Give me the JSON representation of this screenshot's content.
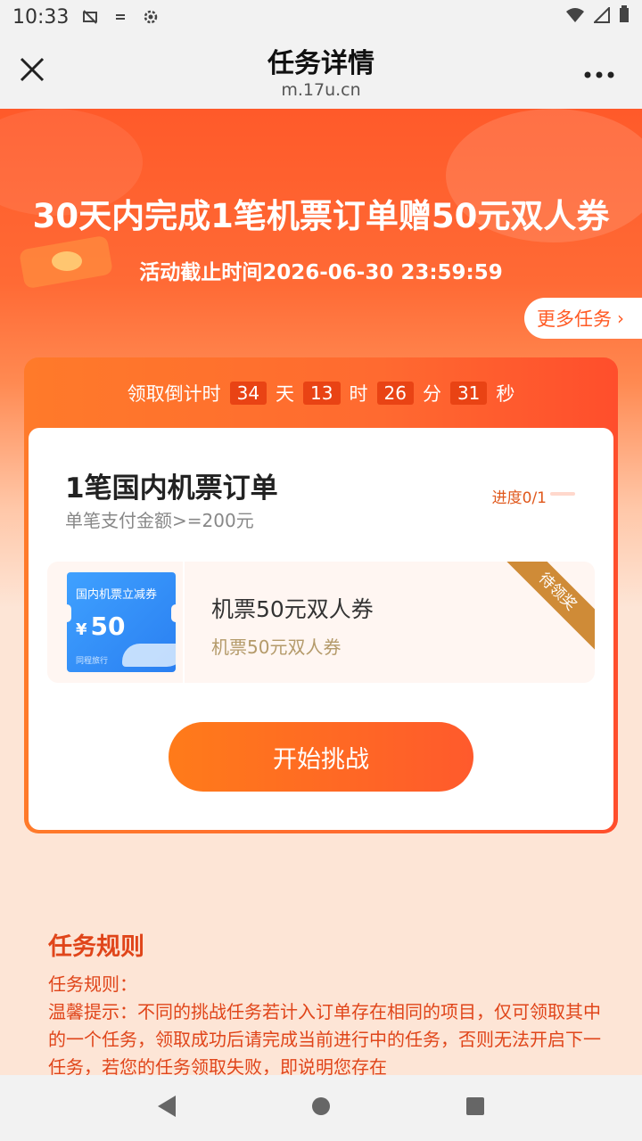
{
  "status_bar": {
    "time": "10:33"
  },
  "nav": {
    "title": "任务详情",
    "url": "m.17u.cn"
  },
  "hero": {
    "title": "30天内完成1笔机票订单赠50元双人券",
    "deadline": "活动截止时间2026-06-30 23:59:59",
    "more_tasks": "更多任务"
  },
  "countdown": {
    "label": "领取倒计时",
    "days": "34",
    "days_unit": "天",
    "hours": "13",
    "hours_unit": "时",
    "minutes": "26",
    "minutes_unit": "分",
    "seconds": "31",
    "seconds_unit": "秒"
  },
  "task": {
    "title": "1笔国内机票订单",
    "subtitle": "单笔支付金额>=200元",
    "progress_text": "进度0/1",
    "progress_fraction": 0
  },
  "reward": {
    "coupon_title": "国内机票立减券",
    "coupon_currency": "¥",
    "coupon_amount": "50",
    "coupon_brand": "同程旅行",
    "name": "机票50元双人券",
    "description": "机票50元双人券",
    "status_ribbon": "待领奖"
  },
  "start_button": "开始挑战",
  "rules": {
    "heading": "任务规则",
    "line1": "任务规则：",
    "line2": "温馨提示：不同的挑战任务若计入订单存在相同的项目，仅可领取其中的一个任务，领取成功后请完成当前进行中的任务，否则无法开启下一任务，若您的任务领取失败，即说明您存在"
  },
  "colors": {
    "brand_orange": "#ff5a24",
    "rules_text": "#e0451a",
    "ribbon": "#cf8b37"
  }
}
